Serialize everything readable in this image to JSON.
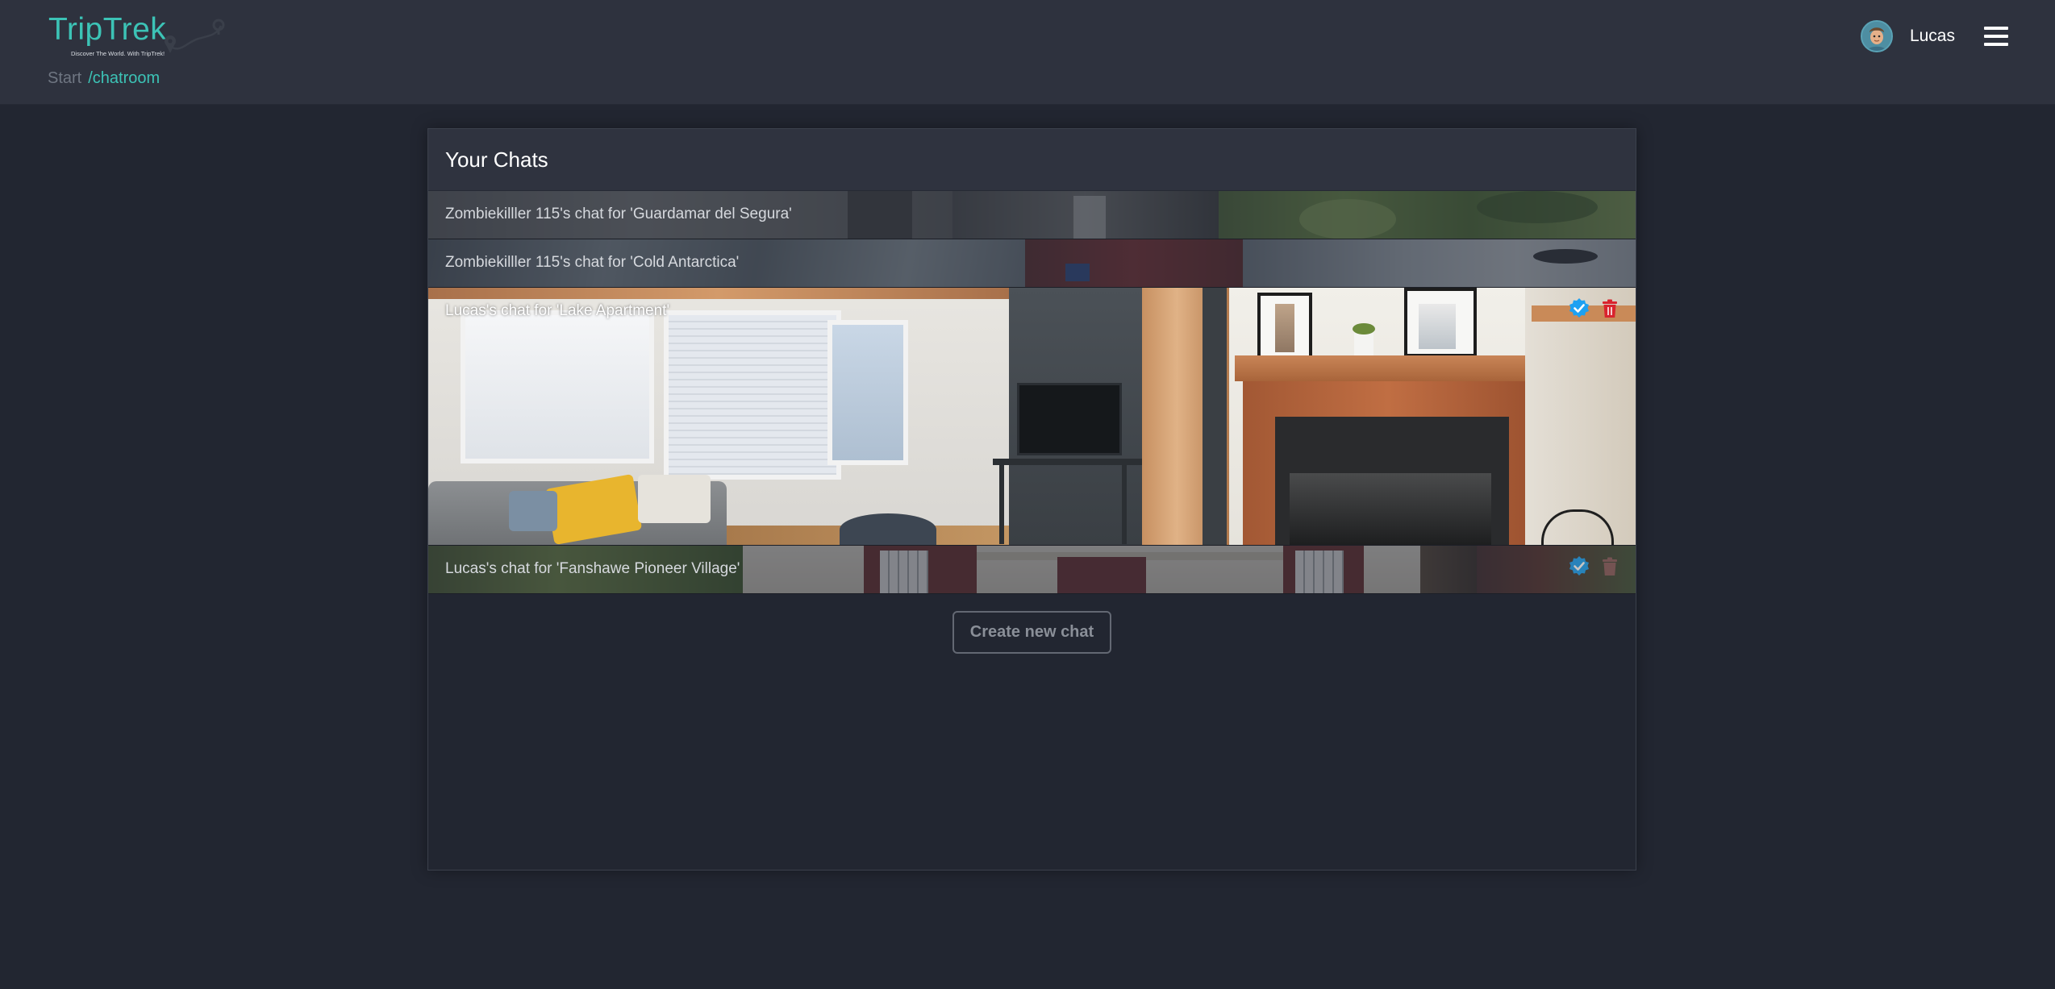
{
  "app": {
    "name": "TripTrek",
    "tagline": "Discover The World. With TripTrek!"
  },
  "breadcrumb": {
    "root": "Start",
    "current": "/chatroom"
  },
  "user": {
    "name": "Lucas",
    "avatar_icon": "avatar-icon",
    "menu_icon": "hamburger-menu-icon"
  },
  "chats_panel": {
    "title": "Your Chats",
    "items": [
      {
        "label": "Zombiekilller 115's chat for 'Guardamar del Segura'",
        "expanded": false,
        "actions": []
      },
      {
        "label": "Zombiekilller 115's chat for 'Cold Antarctica'",
        "expanded": false,
        "actions": []
      },
      {
        "label": "Lucas's chat for 'Lake Apartment'",
        "expanded": true,
        "actions": [
          "verified-check-icon",
          "trash-icon"
        ]
      },
      {
        "label": "Lucas's chat for 'Fanshawe Pioneer Village'",
        "expanded": false,
        "actions": [
          "verified-check-icon",
          "trash-icon"
        ]
      }
    ],
    "create_button": "Create new chat"
  },
  "colors": {
    "background": "#222631",
    "header_bg": "#2e323e",
    "accent": "#3cc3b6",
    "verified": "#1da1f2",
    "delete": "#d9232e"
  }
}
